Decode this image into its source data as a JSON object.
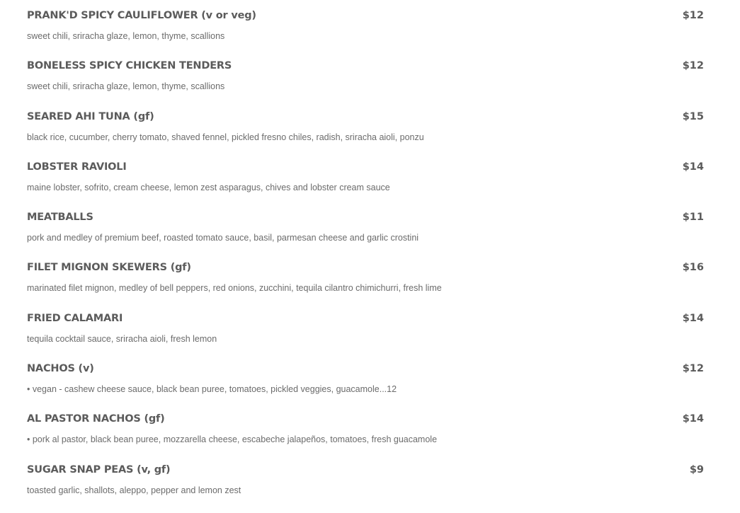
{
  "menu": {
    "items": [
      {
        "name": "PRANK'D SPICY CAULIFLOWER (v or veg)",
        "price": "$12",
        "description": "sweet chili, sriracha glaze, lemon, thyme, scallions"
      },
      {
        "name": "BONELESS SPICY CHICKEN TENDERS",
        "price": "$12",
        "description": "sweet chili, sriracha glaze, lemon, thyme, scallions"
      },
      {
        "name": "SEARED AHI TUNA (gf)",
        "price": "$15",
        "description": "black rice, cucumber, cherry tomato, shaved fennel, pickled fresno chiles, radish, sriracha aioli, ponzu"
      },
      {
        "name": "LOBSTER RAVIOLI",
        "price": "$14",
        "description": "maine lobster, sofrito, cream cheese, lemon zest asparagus, chives and lobster cream sauce"
      },
      {
        "name": "MEATBALLS",
        "price": "$11",
        "description": "pork and medley of premium beef, roasted tomato sauce, basil, parmesan cheese and garlic crostini"
      },
      {
        "name": "FILET MIGNON SKEWERS (gf)",
        "price": "$16",
        "description": "marinated filet mignon, medley of bell peppers, red onions, zucchini, tequila cilantro chimichurri, fresh lime"
      },
      {
        "name": "FRIED CALAMARI",
        "price": "$14",
        "description": "tequila cocktail sauce, sriracha aioli, fresh lemon"
      },
      {
        "name": "NACHOS (v)",
        "price": "$12",
        "description": "• vegan - cashew cheese sauce, black bean puree, tomatoes, pickled veggies, guacamole...12"
      },
      {
        "name": "AL PASTOR NACHOS (gf)",
        "price": "$14",
        "description": "• pork al pastor, black bean puree, mozzarella cheese, escabeche jalapeños, tomatoes, fresh guacamole"
      },
      {
        "name": "SUGAR SNAP PEAS (v, gf)",
        "price": "$9",
        "description": "toasted garlic, shallots, aleppo, pepper and lemon zest"
      }
    ]
  }
}
